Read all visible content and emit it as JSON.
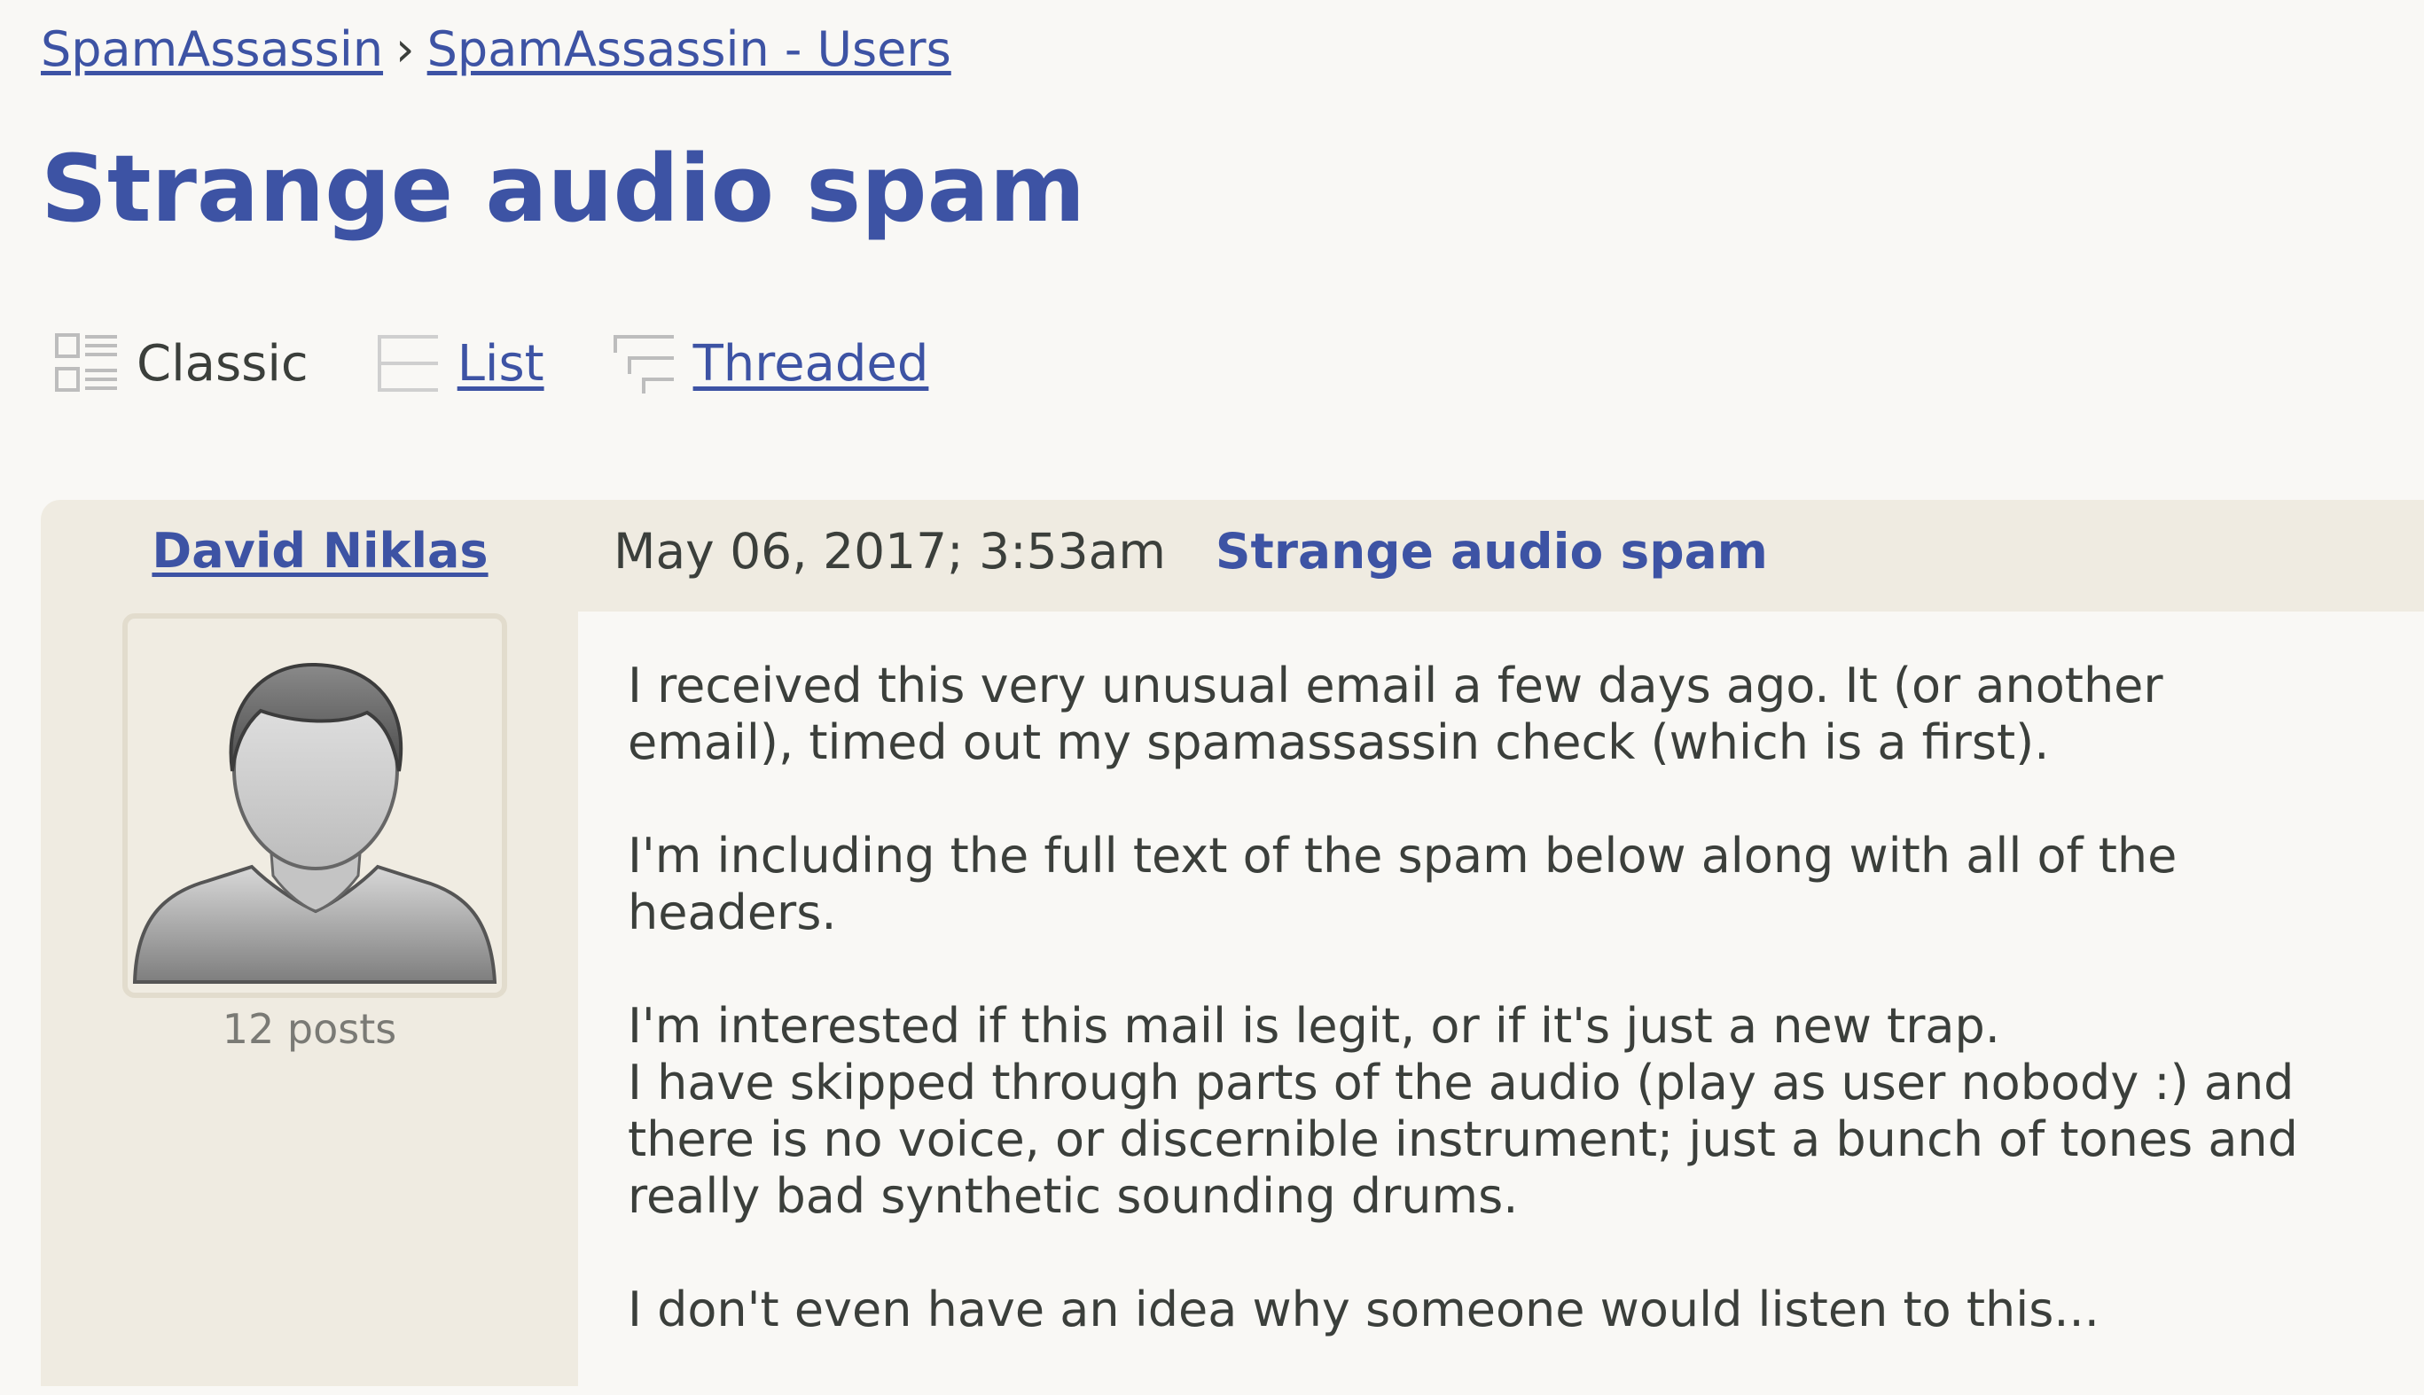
{
  "breadcrumb": {
    "items": [
      "SpamAssassin",
      "SpamAssassin - Users"
    ],
    "separator": "›"
  },
  "page": {
    "title": "Strange audio spam"
  },
  "views": {
    "classic": "Classic",
    "list": "List",
    "threaded": "Threaded"
  },
  "post": {
    "author": "David Niklas",
    "post_count": "12 posts",
    "date": "May 06, 2017; 3:53am",
    "subject": "Strange audio spam",
    "paragraphs": [
      "I received this very unusual email a few days ago. It (or another\nemail), timed out my spamassassin check (which is a first).",
      "I'm including the full text of the spam below along with all of the\nheaders.",
      "I'm interested if this mail is legit, or if it's just a new trap.\nI have skipped through parts of the audio (play as user nobody :)  and\nthere is no voice, or discernible instrument; just a bunch of tones and\nreally bad synthetic sounding drums.",
      "I don't even have an idea why someone would listen to this..."
    ]
  },
  "colors": {
    "link": "#3d53a4",
    "text": "#3b3f3b",
    "page_background": "#f9f8f5",
    "post_sidebar": "#efebe1"
  }
}
